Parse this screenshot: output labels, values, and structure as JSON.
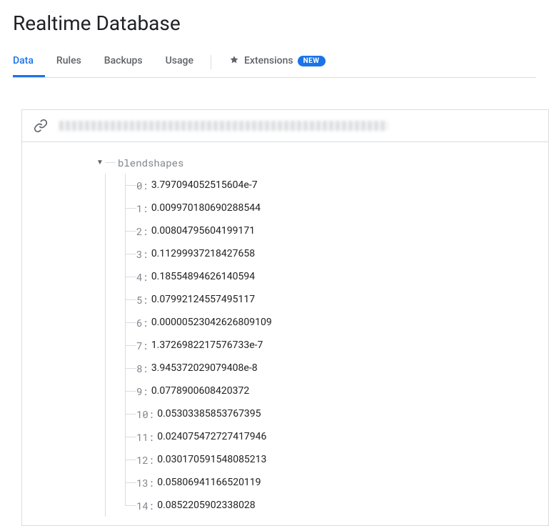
{
  "page_title": "Realtime Database",
  "tabs": {
    "data": "Data",
    "rules": "Rules",
    "backups": "Backups",
    "usage": "Usage",
    "extensions": "Extensions",
    "new_badge": "NEW"
  },
  "tree": {
    "root_key": "blendshapes",
    "items": [
      {
        "key": "0",
        "value": "3.797094052515604e-7"
      },
      {
        "key": "1",
        "value": "0.009970180690288544"
      },
      {
        "key": "2",
        "value": "0.00804795604199171"
      },
      {
        "key": "3",
        "value": "0.11299937218427658"
      },
      {
        "key": "4",
        "value": "0.18554894626140594"
      },
      {
        "key": "5",
        "value": "0.07992124557495117"
      },
      {
        "key": "6",
        "value": "0.00000523042626809109"
      },
      {
        "key": "7",
        "value": "1.3726982217576733e-7"
      },
      {
        "key": "8",
        "value": "3.945372029079408e-8"
      },
      {
        "key": "9",
        "value": "0.0778900608420372"
      },
      {
        "key": "10",
        "value": "0.05303385853767395"
      },
      {
        "key": "11",
        "value": "0.024075472727417946"
      },
      {
        "key": "12",
        "value": "0.030170591548085213"
      },
      {
        "key": "13",
        "value": "0.05806941166520119"
      },
      {
        "key": "14",
        "value": "0.0852205902338028"
      }
    ]
  }
}
